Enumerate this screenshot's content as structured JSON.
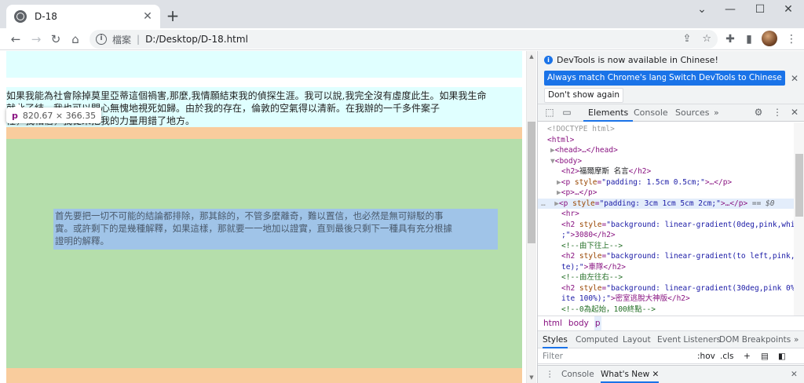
{
  "browser": {
    "tab_title": "D-18",
    "tab_close": "✕",
    "new_tab": "+",
    "window_controls": [
      "⌄",
      "—",
      "☐",
      "✕"
    ],
    "nav": {
      "back": "←",
      "forward": "→",
      "reload": "↻",
      "home": "⌂"
    },
    "omnibox": {
      "security_label": "檔案",
      "separator": "|",
      "url": "D:/Desktop/D-18.html",
      "share_icon": "⇪",
      "bookmark_icon": "☆"
    },
    "toolbar_icons": {
      "extensions": "✚",
      "sidebar": "▮",
      "menu": "⋮"
    }
  },
  "page": {
    "paragraph1_lines": [
      "如果我能為社會除掉莫里亞蒂這個禍害,那麼,我情願結束我的偵探生涯。我可以說,我完全沒有虛度此生。如果我生命",
      "就此了結，我也可以問心無愧地視死如歸。由於我的存在，倫敦的空氣得以清新。在我辦的一千多件案子",
      "裡，我相信，我從未把我的力量用錯了地方。"
    ],
    "paragraph2_lines": [
      "首先要把一切不可能的結論都排除，那其餘的，不管多麼離奇，難以置信，也必然是無可辯駁的事",
      "實。或許剩下的是幾種解釋，如果這樣，那就要一一地加以證實，直到最後只剩下一種具有充分根據",
      "證明的解釋。"
    ],
    "inspector_tooltip": {
      "tag": "p",
      "dimensions": "820.67 × 366.35"
    }
  },
  "devtools": {
    "banner": {
      "message": "DevTools is now available in Chinese!",
      "button_match": "Always match Chrome's language",
      "button_switch": "Switch DevTools to Chinese",
      "button_dismiss": "Don't show again",
      "close": "✕"
    },
    "tabs": [
      "Elements",
      "Console",
      "Sources",
      "»"
    ],
    "top_icons": {
      "inspect": "⬚",
      "device": "▭",
      "settings": "⚙",
      "more": "⋮",
      "close": "✕"
    },
    "dom": {
      "doctype": "<!DOCTYPE html>",
      "html_open": "<html>",
      "head": "<head>…</head>",
      "body_open": "<body>",
      "h2_open": "<h2>",
      "h2_text": "福爾摩斯 名言",
      "h2_close": "</h2>",
      "p1_open": "<p ",
      "p_style_attr": "style",
      "p1_style_val": "\"padding: 1.5cm 0.5cm;\"",
      "p1_close": ">…</p>",
      "p2": "<p>…</p>",
      "p3_style_val": "\"padding: 3cm 1cm 5cm 2cm;\"",
      "p3_close": ">…</p>",
      "sel_marker": " == $0",
      "dots": "…",
      "hr": "<hr>",
      "h2a_val_1": "\"background: linear-gradient(0deg,pink,white)",
      "h2a_val_2": ";\"",
      "h2a_text": ">3080</h2>",
      "c1": "<!--由下往上-->",
      "h2b_val_1": "\"background: linear-gradient(to left,pink,whi",
      "h2b_val_2": "te);\"",
      "h2b_text": ">車隊</h2>",
      "c2": "<!--由左往右-->",
      "h2c_val_1": "\"background: linear-gradient(30deg,pink 0%,wh",
      "h2c_val_2": "ite 100%);\"",
      "h2c_text": ">密室逃脫大神版</h2>",
      "c3": "<!--0為起始，100終點-->"
    },
    "breadcrumbs": [
      "html",
      "body",
      "p"
    ],
    "styles_tabs": [
      "Styles",
      "Computed",
      "Layout",
      "Event Listeners",
      "DOM Breakpoints",
      "»"
    ],
    "filter": {
      "placeholder": "Filter",
      "hov": ":hov",
      "cls": ".cls",
      "plus": "+"
    },
    "drawer": {
      "menu": "⋮",
      "console": "Console",
      "whats_new": "What's New",
      "close": "✕",
      "drawer_close": "✕"
    }
  }
}
